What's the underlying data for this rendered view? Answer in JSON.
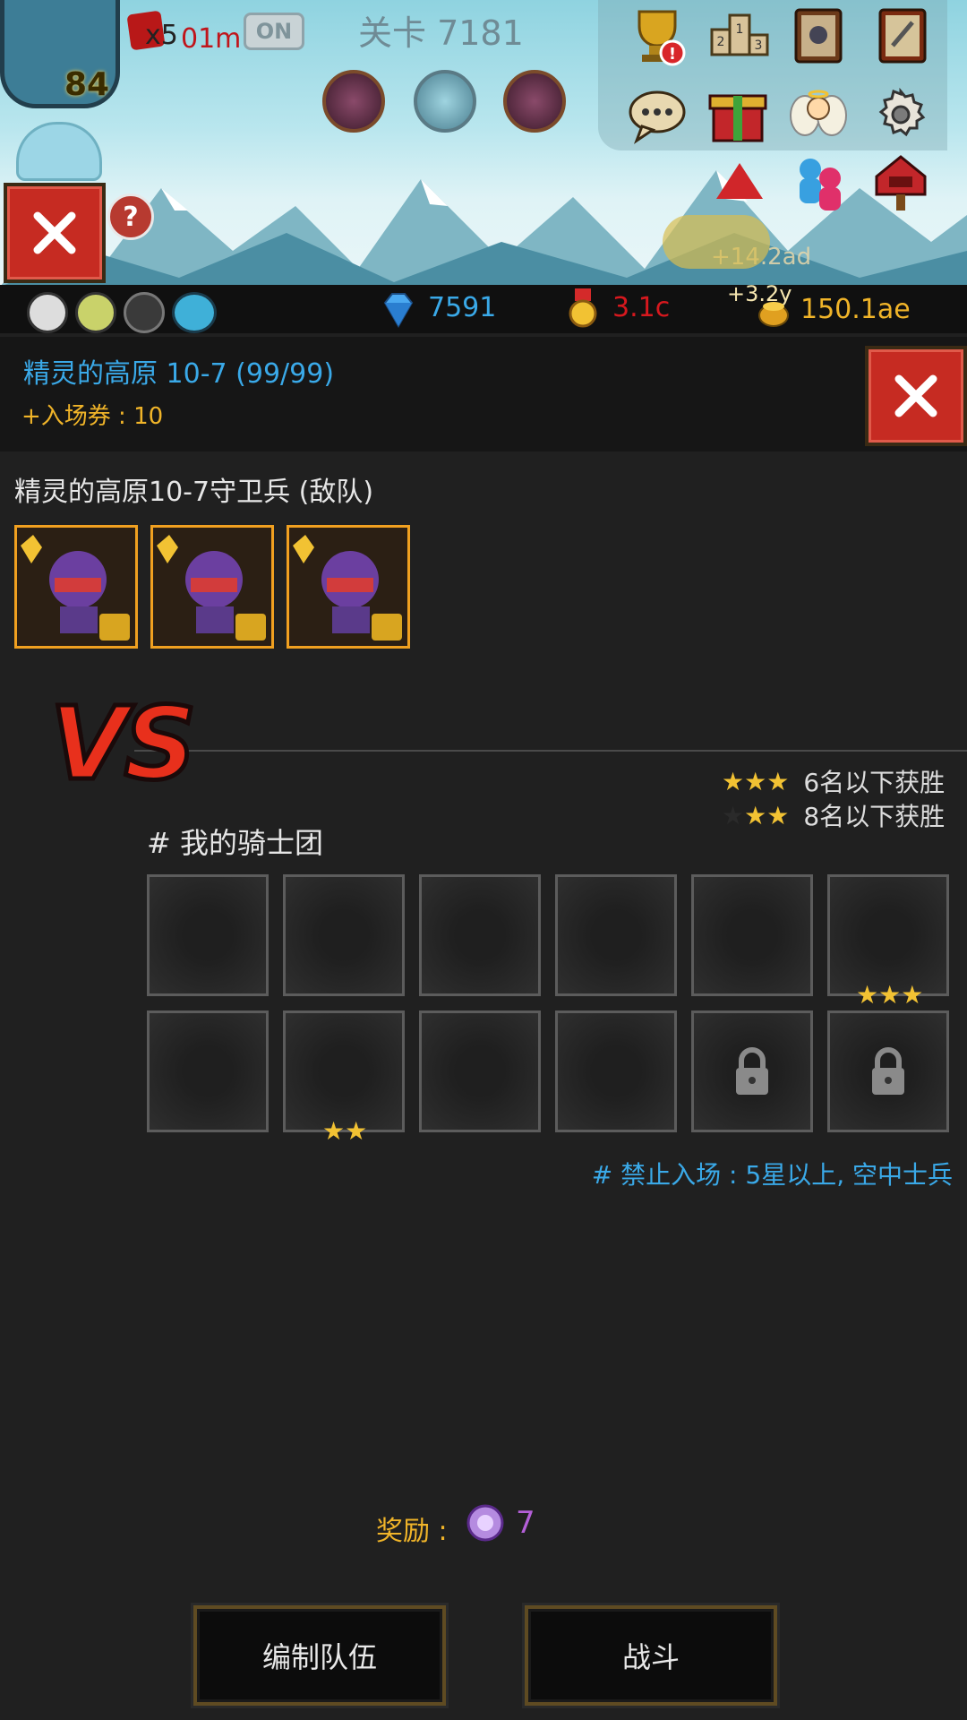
{
  "hud": {
    "energy_multiplier": "x5",
    "energy_timer": "01m",
    "auto_toggle": "ON",
    "stage_title": "关卡 7181",
    "hero_level": "84",
    "help_symbol": "?",
    "floating_bonus": "+14.2ad"
  },
  "resources": {
    "gems": "7591",
    "medals": "3.1c",
    "gold_rate": "+3.2y",
    "gold": "150.1ae"
  },
  "dungeon": {
    "title": "精灵的高原 10-7 (99/99)",
    "ticket": "+入场券 : 10",
    "enemy_label": "精灵的高原10-7守卫兵 (敌队)",
    "vs_text": "VS",
    "condition_3star": "6名以下获胜",
    "condition_2star": "8名以下获胜",
    "my_team_label": "# 我的骑士团",
    "restriction": "# 禁止入场 : 5星以上, 空中士兵",
    "reward_label": "奖励 :",
    "reward_value": "7"
  },
  "buttons": {
    "edit_team": "编制队伍",
    "battle": "战斗"
  },
  "colors": {
    "accent_blue": "#3aa9e8",
    "gold_text": "#f0b429",
    "red_text": "#d6181e",
    "purple_text": "#b45fd8",
    "frame_orange": "#f0a020"
  }
}
